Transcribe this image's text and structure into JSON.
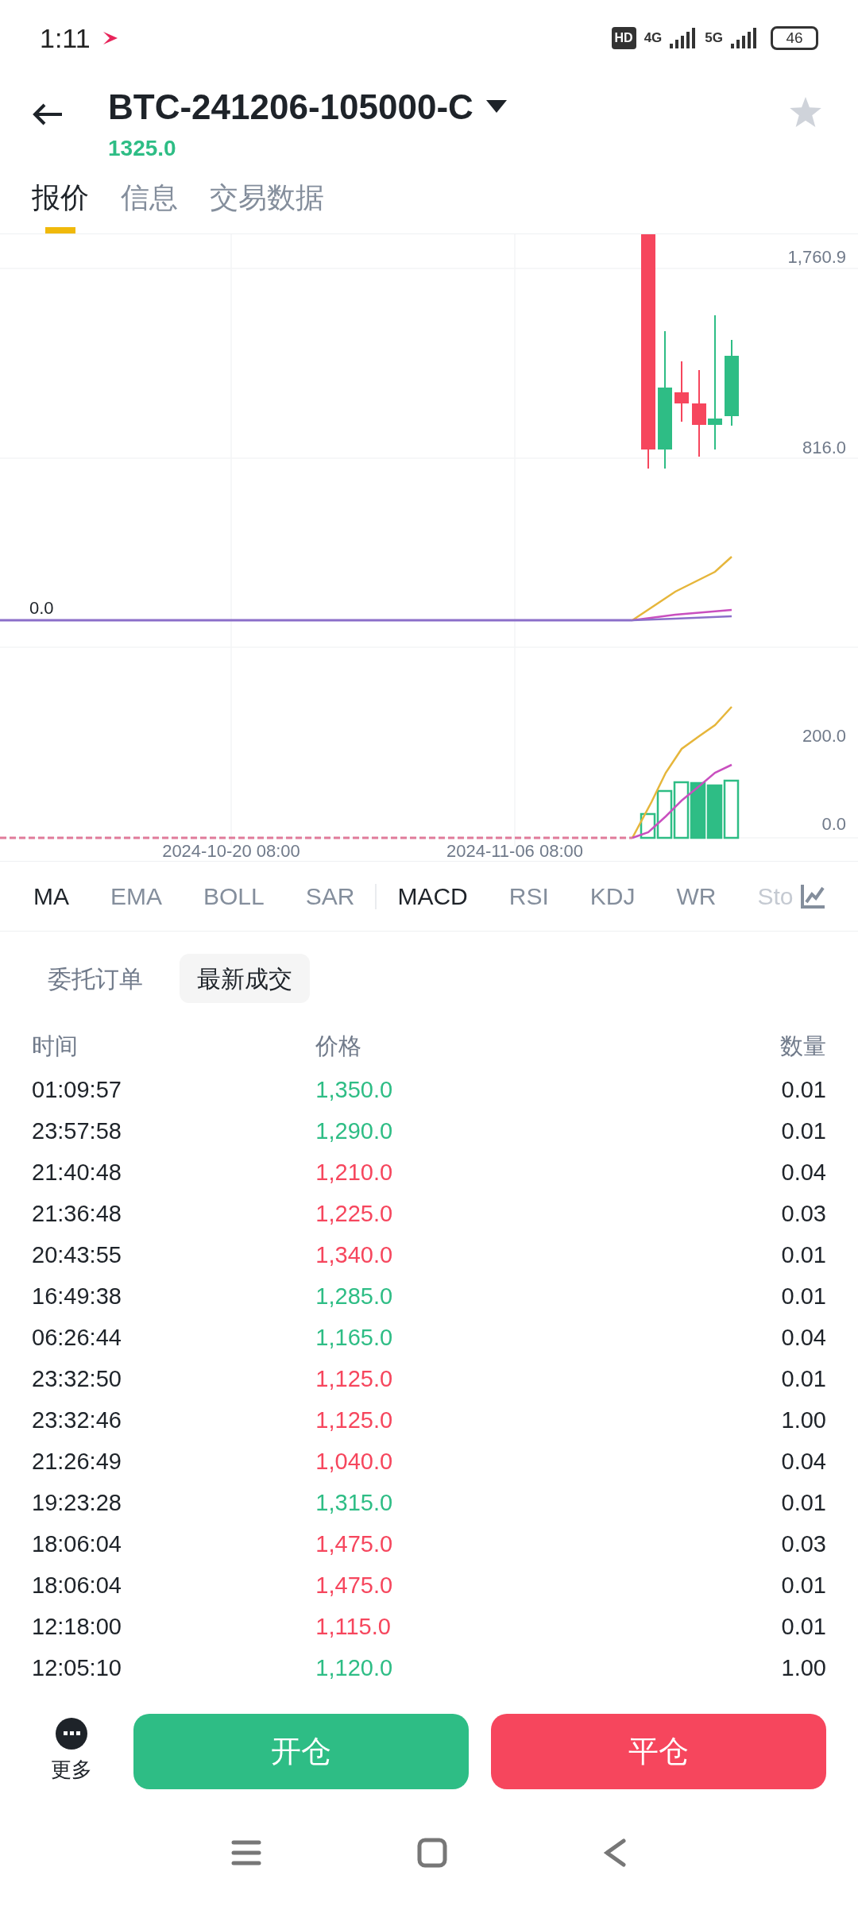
{
  "status_bar": {
    "time": "1:11",
    "hd": "HD",
    "network_1": "4G",
    "network_2": "5G",
    "battery": "46"
  },
  "header": {
    "title": "BTC-241206-105000-C",
    "price": "1325.0"
  },
  "tabs": [
    {
      "label": "报价",
      "selected": true
    },
    {
      "label": "信息",
      "selected": false
    },
    {
      "label": "交易数据",
      "selected": false
    }
  ],
  "chart": {
    "price_labels": [
      "1,760.9",
      "816.0"
    ],
    "macd_zero": "0.0",
    "volume_labels": [
      "200.0",
      "0.0"
    ],
    "date_labels": [
      "2024-10-20 08:00",
      "2024-11-06 08:00"
    ]
  },
  "indicators": [
    {
      "label": "MA",
      "selected": true
    },
    {
      "label": "EMA",
      "selected": false
    },
    {
      "label": "BOLL",
      "selected": false
    },
    {
      "label": "SAR",
      "selected": false
    },
    {
      "label": "MACD",
      "selected": true
    },
    {
      "label": "RSI",
      "selected": false
    },
    {
      "label": "KDJ",
      "selected": false
    },
    {
      "label": "WR",
      "selected": false
    },
    {
      "label": "Sto",
      "selected": false
    }
  ],
  "order_tabs": [
    {
      "label": "委托订单",
      "selected": false
    },
    {
      "label": "最新成交",
      "selected": true
    }
  ],
  "trades": {
    "columns": [
      "时间",
      "价格",
      "数量"
    ],
    "rows": [
      {
        "time": "01:09:57",
        "price": "1,350.0",
        "qty": "0.01",
        "color": "#2ebd85"
      },
      {
        "time": "23:57:58",
        "price": "1,290.0",
        "qty": "0.01",
        "color": "#2ebd85"
      },
      {
        "time": "21:40:48",
        "price": "1,210.0",
        "qty": "0.04",
        "color": "#f6465d"
      },
      {
        "time": "21:36:48",
        "price": "1,225.0",
        "qty": "0.03",
        "color": "#f6465d"
      },
      {
        "time": "20:43:55",
        "price": "1,340.0",
        "qty": "0.01",
        "color": "#f6465d"
      },
      {
        "time": "16:49:38",
        "price": "1,285.0",
        "qty": "0.01",
        "color": "#2ebd85"
      },
      {
        "time": "06:26:44",
        "price": "1,165.0",
        "qty": "0.04",
        "color": "#2ebd85"
      },
      {
        "time": "23:32:50",
        "price": "1,125.0",
        "qty": "0.01",
        "color": "#f6465d"
      },
      {
        "time": "23:32:46",
        "price": "1,125.0",
        "qty": "1.00",
        "color": "#f6465d"
      },
      {
        "time": "21:26:49",
        "price": "1,040.0",
        "qty": "0.04",
        "color": "#f6465d"
      },
      {
        "time": "19:23:28",
        "price": "1,315.0",
        "qty": "0.01",
        "color": "#2ebd85"
      },
      {
        "time": "18:06:04",
        "price": "1,475.0",
        "qty": "0.03",
        "color": "#f6465d"
      },
      {
        "time": "18:06:04",
        "price": "1,475.0",
        "qty": "0.01",
        "color": "#f6465d"
      },
      {
        "time": "12:18:00",
        "price": "1,115.0",
        "qty": "0.01",
        "color": "#f6465d"
      },
      {
        "time": "12:05:10",
        "price": "1,120.0",
        "qty": "1.00",
        "color": "#2ebd85"
      }
    ]
  },
  "bottom_bar": {
    "more": "更多",
    "buttons": [
      {
        "label": "开仓",
        "kind": "open"
      },
      {
        "label": "平仓",
        "kind": "close"
      }
    ]
  }
}
